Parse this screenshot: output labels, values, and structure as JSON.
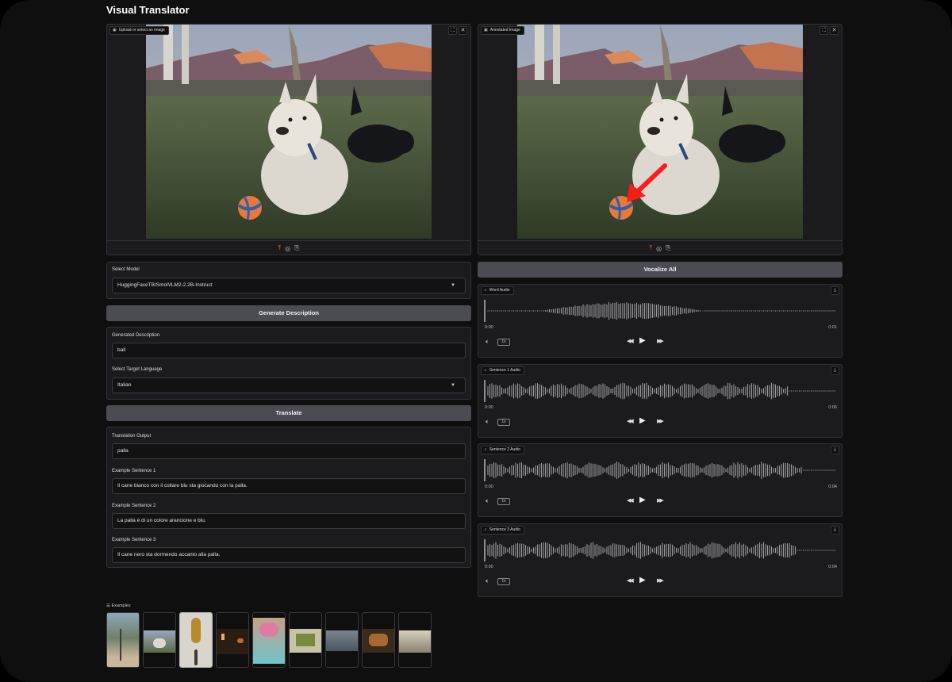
{
  "app": {
    "title": "Visual Translator"
  },
  "upload_panel": {
    "label": "Upload or select an image"
  },
  "annotated_panel": {
    "label": "Annotated Image"
  },
  "model": {
    "label": "Select Model",
    "value": "HuggingFaceTB/SmolVLM2-2.2B-Instruct"
  },
  "generate_button": "Generate Description",
  "description": {
    "label": "Generated Description",
    "value": "ball"
  },
  "target_language": {
    "label": "Select Target Language",
    "value": "Italian"
  },
  "translate_button": "Translate",
  "translation": {
    "label": "Translation Output",
    "value": "palla",
    "sentences": [
      {
        "label": "Example Sentence 1",
        "value": "Il cane bianco con il collare blu sta giocando con la palla."
      },
      {
        "label": "Example Sentence 2",
        "value": "La palla è di un colore arancione e blu."
      },
      {
        "label": "Example Sentence 3",
        "value": "Il cane nero sta dormendo accanto alla palla."
      }
    ]
  },
  "vocalize_button": "Vocalize All",
  "audio_players": [
    {
      "label": "Word Audio",
      "start": "0:00",
      "end": "0:01",
      "rate": "1x"
    },
    {
      "label": "Sentence 1 Audio",
      "start": "0:00",
      "end": "0:06",
      "rate": "1x"
    },
    {
      "label": "Sentence 2 Audio",
      "start": "0:00",
      "end": "0:04",
      "rate": "1x"
    },
    {
      "label": "Sentence 3 Audio",
      "start": "0:00",
      "end": "0:04",
      "rate": "1x"
    }
  ],
  "examples": {
    "label": "Examples",
    "count": 9
  },
  "colors": {
    "accent": "#e8793a",
    "button": "#4b4b52",
    "panel": "#1b1b1d",
    "background": "#0f0f10"
  }
}
